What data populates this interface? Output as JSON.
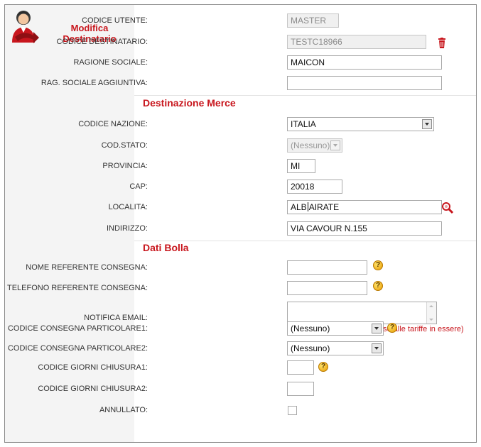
{
  "sidebar": {
    "title_line1": "Modifica",
    "title_line2": "Destinatario",
    "icon": "user-edit-icon"
  },
  "fields": {
    "codice_utente": {
      "label": "CODICE UTENTE:",
      "value": "MASTER"
    },
    "codice_destinatario": {
      "label": "CODICE DESTINATARIO:",
      "value": "TESTC18966"
    },
    "ragione_sociale": {
      "label": "RAGIONE SOCIALE:",
      "value": "MAICON"
    },
    "rag_sociale_aggiuntiva": {
      "label": "RAG. SOCIALE AGGIUNTIVA:",
      "value": ""
    }
  },
  "sections": {
    "destinazione": "Destinazione Merce",
    "bolla": "Dati Bolla"
  },
  "destinazione": {
    "codice_nazione": {
      "label": "CODICE NAZIONE:",
      "value": "ITALIA"
    },
    "cod_stato": {
      "label": "COD.STATO:",
      "value": "(Nessuno)"
    },
    "provincia": {
      "label": "PROVINCIA:",
      "value": "MI"
    },
    "cap": {
      "label": "CAP:",
      "value": "20018"
    },
    "localita": {
      "label": "LOCALITA:",
      "value_a": "ALB",
      "value_b": "AIRATE"
    },
    "indirizzo": {
      "label": "INDIRIZZO:",
      "value": "VIA CAVOUR N.155"
    }
  },
  "bolla": {
    "nome_referente": {
      "label": "NOME REFERENTE CONSEGNA:",
      "value": ""
    },
    "telefono_referente": {
      "label": "TELEFONO REFERENTE CONSEGNA:",
      "value": ""
    },
    "notifica_email": {
      "label": "NOTIFICA EMAIL:",
      "value": "",
      "note": "(servizio a pagamento in base alle tariffe in essere)"
    },
    "consegna_particolare1": {
      "label": "CODICE CONSEGNA PARTICOLARE1:",
      "value": "(Nessuno)"
    },
    "consegna_particolare2": {
      "label": "CODICE CONSEGNA PARTICOLARE2:",
      "value": "(Nessuno)"
    },
    "giorni_chiusura1": {
      "label": "CODICE GIORNI CHIUSURA1:",
      "value": ""
    },
    "giorni_chiusura2": {
      "label": "CODICE GIORNI CHIUSURA2:",
      "value": ""
    },
    "annullato": {
      "label": "ANNULLATO:",
      "checked": false
    }
  },
  "help_glyph": "?",
  "colors": {
    "accent": "#c8161d",
    "sidebar_bg": "#f4f4f4",
    "help": "#f0b400"
  }
}
